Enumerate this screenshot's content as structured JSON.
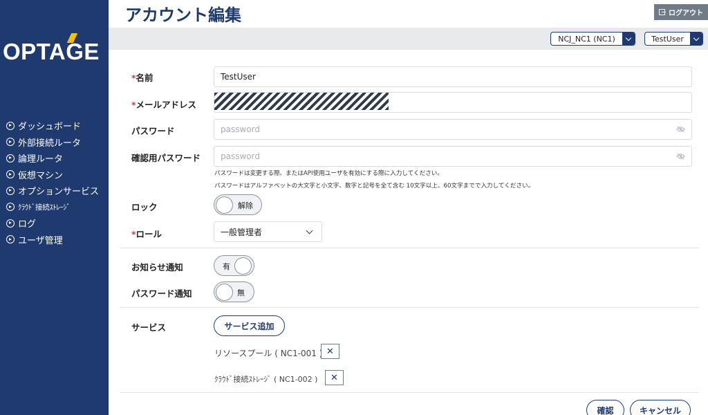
{
  "brand": {
    "logo_text": "OPTAGE"
  },
  "sidebar": {
    "items": [
      {
        "label": "ダッシュボード"
      },
      {
        "label": "外部接続ルータ"
      },
      {
        "label": "論理ルータ"
      },
      {
        "label": "仮想マシン"
      },
      {
        "label": "オプションサービス"
      },
      {
        "label": "ｸﾗｳﾄﾞ接続ｽﾄﾚｰｼﾞ"
      },
      {
        "label": "ログ"
      },
      {
        "label": "ユーザ管理"
      }
    ]
  },
  "header": {
    "title": "アカウント編集",
    "logout_label": "ログアウト",
    "tenant_select": "NCJ_NC1 (NC1)",
    "user_select": "TestUser"
  },
  "form": {
    "name": {
      "required_mark": "*",
      "label": "名前",
      "value": "TestUser"
    },
    "email": {
      "required_mark": "*",
      "label": "メールアドレス"
    },
    "password": {
      "label": "パスワード",
      "placeholder": "password"
    },
    "confirm_password": {
      "label": "確認用パスワード",
      "placeholder": "password"
    },
    "help_line1": "パスワードは変更する際、またはAPI使用ユーザを有効にする際に入力してください。",
    "help_line2": "パスワードはアルファベットの大文字と小文字、数字と記号を全て含む 10文字以上、60文字までで入力してください。",
    "lock": {
      "label": "ロック",
      "toggle_text": "解除",
      "enabled": false
    },
    "role": {
      "required_mark": "*",
      "label": "ロール",
      "value": "一般管理者"
    },
    "notice": {
      "label": "お知らせ通知",
      "toggle_text": "有",
      "enabled": true
    },
    "password_notice": {
      "label": "パスワード通知",
      "toggle_text": "無",
      "enabled": false
    },
    "service": {
      "label": "サービス",
      "add_button": "サービス追加",
      "items": [
        {
          "text": "リソースプール ( NC1-001 )",
          "remove": "✕"
        },
        {
          "text": "ｸﾗｳﾄﾞ接続ｽﾄﾚｰｼﾞ ( NC1-002 )",
          "remove": "✕"
        }
      ]
    }
  },
  "footer": {
    "confirm_label": "確認",
    "cancel_label": "キャンセル"
  },
  "colors": {
    "sidebar": "#1e3a6e",
    "accent": "#1e3a6e",
    "required": "#d8324a",
    "logo_accent": "#f2c200"
  }
}
